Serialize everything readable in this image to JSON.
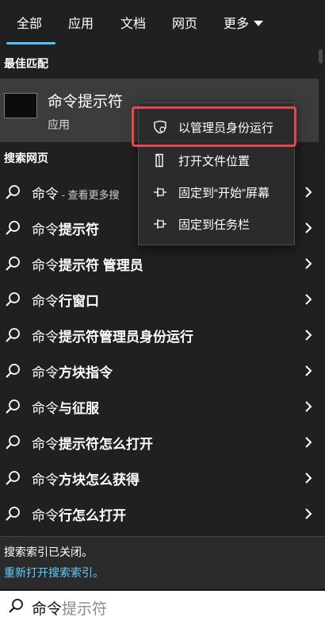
{
  "tabs": [
    {
      "label": "全部"
    },
    {
      "label": "应用"
    },
    {
      "label": "文档"
    },
    {
      "label": "网页"
    },
    {
      "label": "更多"
    }
  ],
  "best_match": {
    "section_title": "最佳匹配",
    "name": "命令提示符",
    "type": "应用"
  },
  "web": {
    "section_title": "搜索网页",
    "results": [
      {
        "query": "命令",
        "bold": "",
        "suffix": " - 查看更多搜"
      },
      {
        "query": "命令",
        "bold": "提示符",
        "suffix": ""
      },
      {
        "query": "命令",
        "bold": "提示符 管理员",
        "suffix": ""
      },
      {
        "query": "命令",
        "bold": "行窗口",
        "suffix": ""
      },
      {
        "query": "命令",
        "bold": "提示符管理员身份运行",
        "suffix": ""
      },
      {
        "query": "命令",
        "bold": "方块指令",
        "suffix": ""
      },
      {
        "query": "命令",
        "bold": "与征服",
        "suffix": ""
      },
      {
        "query": "命令",
        "bold": "提示符怎么打开",
        "suffix": ""
      },
      {
        "query": "命令",
        "bold": "方块怎么获得",
        "suffix": ""
      },
      {
        "query": "命令",
        "bold": "行怎么打开",
        "suffix": ""
      }
    ]
  },
  "context_menu": {
    "items": [
      {
        "label": "以管理员身份运行",
        "icon": "shield-icon"
      },
      {
        "label": "打开文件位置",
        "icon": "folder-icon"
      },
      {
        "label": "固定到“开始”屏幕",
        "icon": "pin-icon"
      },
      {
        "label": "固定到任务栏",
        "icon": "pin-icon"
      }
    ]
  },
  "notice": {
    "line1": "搜索索引已关闭。",
    "line2": "重新打开搜索索引。"
  },
  "search": {
    "typed": "命令",
    "suggestion": "提示符"
  },
  "colors": {
    "accent": "#4cc2ff",
    "link": "#60cdff",
    "highlight_box": "#e8474c",
    "selected_bg": "#3c3c3c"
  }
}
